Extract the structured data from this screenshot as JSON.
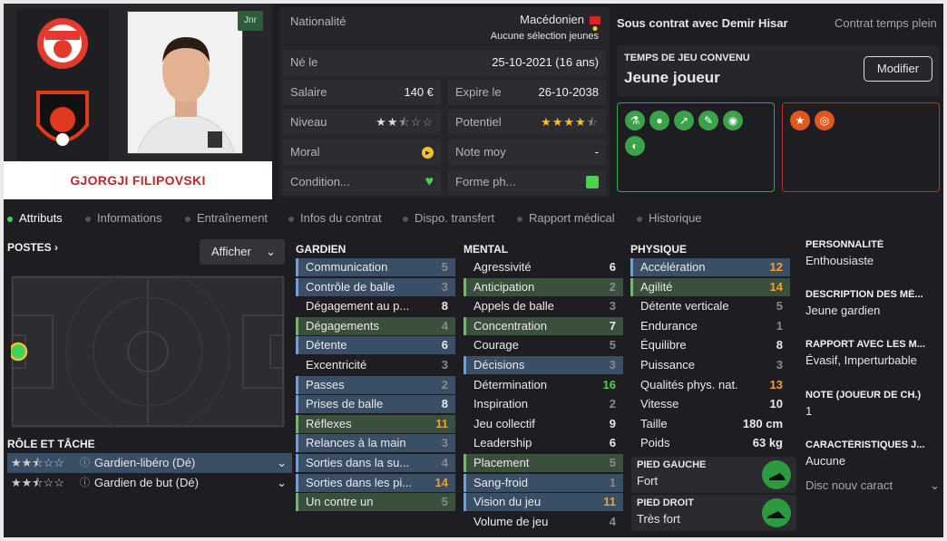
{
  "player": {
    "name": "GJORGJI FILIPOVSKI",
    "badge": "Jnr"
  },
  "info": {
    "nationality_label": "Nationalité",
    "nationality": "Macédonien",
    "caps": "Aucune sélection jeunes",
    "born_label": "Né le",
    "born": "25-10-2021 (16 ans)",
    "salary_label": "Salaire",
    "salary": "140 €",
    "expires_label": "Expire le",
    "expires": "26-10-2038",
    "level_label": "Niveau",
    "level_stars": 2.5,
    "potential_label": "Potentiel",
    "potential_stars": 4.5,
    "morale_label": "Moral",
    "avg_label": "Note moy",
    "avg": "-",
    "condition_label": "Condition...",
    "form_label": "Forme ph..."
  },
  "contract": {
    "club": "Sous contrat avec Demir Hisar",
    "type": "Contrat temps plein",
    "playtime_title": "TEMPS DE JEU CONVENU",
    "playtime": "Jeune joueur",
    "modify": "Modifier"
  },
  "tabs": [
    "Attributs",
    "Informations",
    "Entraînement",
    "Infos du contrat",
    "Dispo. transfert",
    "Rapport médical",
    "Historique"
  ],
  "positions": {
    "title": "POSTES",
    "show": "Afficher"
  },
  "roles": {
    "title": "RÔLE ET TÂCHE",
    "items": [
      {
        "label": "Gardien-libéro (Dé)",
        "stars": 2.5
      },
      {
        "label": "Gardien de but (Dé)",
        "stars": 2.5
      }
    ]
  },
  "gk": {
    "title": "GARDIEN",
    "items": [
      [
        "Communication",
        "5",
        "b"
      ],
      [
        "Contrôle de balle",
        "3",
        "b"
      ],
      [
        "Dégagement au p...",
        "8",
        ""
      ],
      [
        "Dégagements",
        "4",
        "g"
      ],
      [
        "Détente",
        "6",
        "b"
      ],
      [
        "Excentricité",
        "3",
        ""
      ],
      [
        "Passes",
        "2",
        "b"
      ],
      [
        "Prises de balle",
        "8",
        "b"
      ],
      [
        "Réflexes",
        "11",
        "g"
      ],
      [
        "Relances à la main",
        "3",
        "b"
      ],
      [
        "Sorties dans la su...",
        "4",
        "b"
      ],
      [
        "Sorties dans les pi...",
        "14",
        "b"
      ],
      [
        "Un contre un",
        "5",
        "g"
      ]
    ]
  },
  "mental": {
    "title": "MENTAL",
    "items": [
      [
        "Agressivité",
        "6",
        ""
      ],
      [
        "Anticipation",
        "2",
        "g"
      ],
      [
        "Appels de balle",
        "3",
        ""
      ],
      [
        "Concentration",
        "7",
        "g"
      ],
      [
        "Courage",
        "5",
        ""
      ],
      [
        "Décisions",
        "3",
        "b"
      ],
      [
        "Détermination",
        "16",
        ""
      ],
      [
        "Inspiration",
        "2",
        ""
      ],
      [
        "Jeu collectif",
        "9",
        ""
      ],
      [
        "Leadership",
        "6",
        ""
      ],
      [
        "Placement",
        "5",
        "g"
      ],
      [
        "Sang-froid",
        "1",
        "b"
      ],
      [
        "Vision du jeu",
        "11",
        "b"
      ],
      [
        "Volume de jeu",
        "4",
        ""
      ]
    ]
  },
  "physical": {
    "title": "PHYSIQUE",
    "items": [
      [
        "Accélération",
        "12",
        "b"
      ],
      [
        "Agilité",
        "14",
        "g"
      ],
      [
        "Détente verticale",
        "5",
        ""
      ],
      [
        "Endurance",
        "1",
        ""
      ],
      [
        "Équilibre",
        "8",
        ""
      ],
      [
        "Puissance",
        "3",
        ""
      ],
      [
        "Qualités phys. nat.",
        "13",
        ""
      ],
      [
        "Vitesse",
        "10",
        ""
      ],
      [
        "Taille",
        "180 cm",
        ""
      ],
      [
        "Poids",
        "63 kg",
        ""
      ]
    ]
  },
  "feet": {
    "left_title": "PIED GAUCHE",
    "left": "Fort",
    "right_title": "PIED DROIT",
    "right": "Très fort"
  },
  "sidebar": [
    {
      "t": "PERSONNALITÉ",
      "d": "Enthousiaste"
    },
    {
      "t": "DESCRIPTION DES MÉ...",
      "d": "Jeune gardien"
    },
    {
      "t": "RAPPORT AVEC LES M...",
      "d": "Évasif, Imperturbable"
    },
    {
      "t": "NOTE (JOUEUR DE CH.)",
      "d": "1"
    },
    {
      "t": "CARACTÉRISTIQUES J...",
      "d": "Aucune"
    }
  ],
  "traits_new": "Disc nouv caract",
  "colors": {
    "blue": "#6fa0d8",
    "green": "#78b56f",
    "orange": "#f0a030",
    "bright_green": "#4ad24a"
  }
}
